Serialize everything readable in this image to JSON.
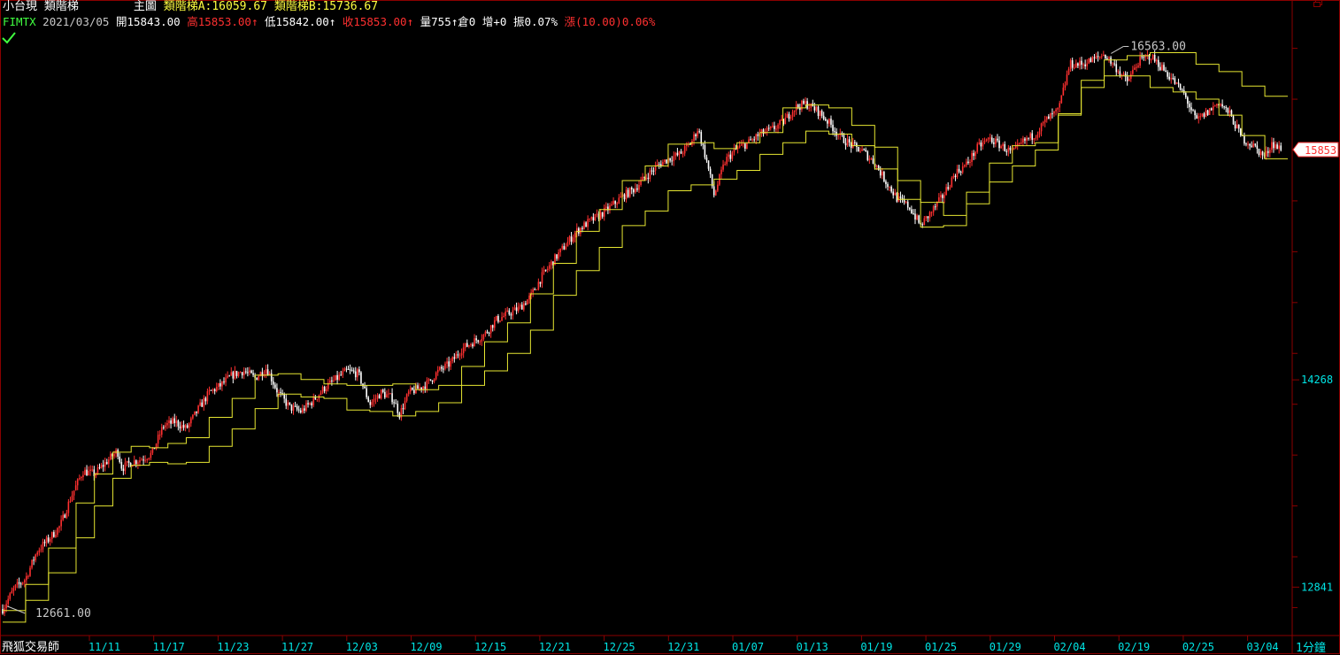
{
  "header": {
    "instrument_name": "小台現",
    "indicator_name": "類階梯",
    "main_label": "主圖",
    "stair_a_label": "類階梯A:",
    "stair_a_value": "16059.67",
    "stair_b_label": "類階梯B:",
    "stair_b_value": "15736.67",
    "symbol": "FIMTX",
    "date": "2021/03/05",
    "open_label": "開",
    "open_value": "15843.00",
    "high_label": "高",
    "high_value": "15853.00",
    "low_label": "低",
    "low_value": "15842.00",
    "close_label": "收",
    "close_value": "15853.00",
    "volume_label": "量",
    "volume_value": "755",
    "oi_label": "倉",
    "oi_value": "0",
    "oi_change_label": "增",
    "oi_change_value": "+0",
    "amplitude_label": "振",
    "amplitude_value": "0.07%",
    "change_label": "漲",
    "change_value": "(10.00)",
    "change_pct": "0.06%",
    "arrow_up": "↑"
  },
  "footer": {
    "brand": "飛狐交易師",
    "period": "1分鐘"
  },
  "colors": {
    "background": "#000000",
    "frame": "#8b0000",
    "axis_text": "#00e5e5",
    "stair_line": "#e6e632",
    "candle_up": "#ff3030",
    "candle_down": "#ffffff",
    "price_tag": "#ff3030"
  },
  "icons": [
    "check-icon",
    "window-restore-icon"
  ],
  "chart_data": {
    "type": "candlestick",
    "y_ticks": [
      12841,
      14268
    ],
    "ylim": [
      12520,
      16700
    ],
    "x_ticks": [
      "11/11",
      "11/17",
      "11/23",
      "11/27",
      "12/03",
      "12/09",
      "12/15",
      "12/21",
      "12/25",
      "12/31",
      "01/07",
      "01/13",
      "01/19",
      "01/25",
      "01/29",
      "02/04",
      "02/19",
      "02/25",
      "03/04"
    ],
    "last_price": "15853",
    "max_label": "16563.00",
    "min_label": "12661.00",
    "grid": false,
    "price_path": [
      [
        0,
        12690
      ],
      [
        0.5,
        12830
      ],
      [
        1,
        12900
      ],
      [
        1.5,
        13090
      ],
      [
        2,
        13170
      ],
      [
        2.5,
        13260
      ],
      [
        3,
        13470
      ],
      [
        3.5,
        13640
      ],
      [
        4,
        13620
      ],
      [
        4.5,
        13700
      ],
      [
        5,
        13780
      ],
      [
        5.2,
        13660
      ],
      [
        5.6,
        13700
      ],
      [
        6,
        13720
      ],
      [
        6.5,
        13760
      ],
      [
        7,
        13950
      ],
      [
        7.5,
        13980
      ],
      [
        8,
        13930
      ],
      [
        8.5,
        14060
      ],
      [
        9,
        14180
      ],
      [
        9.5,
        14230
      ],
      [
        10,
        14300
      ],
      [
        10.5,
        14330
      ],
      [
        11,
        14280
      ],
      [
        11.5,
        14350
      ],
      [
        12,
        14180
      ],
      [
        12.5,
        14080
      ],
      [
        13,
        14050
      ],
      [
        13.5,
        14120
      ],
      [
        14,
        14210
      ],
      [
        14.5,
        14270
      ],
      [
        15,
        14330
      ],
      [
        15.5,
        14310
      ],
      [
        16,
        14100
      ],
      [
        16.5,
        14180
      ],
      [
        17,
        14140
      ],
      [
        17.3,
        14030
      ],
      [
        17.7,
        14180
      ],
      [
        18,
        14200
      ],
      [
        18.5,
        14240
      ],
      [
        19,
        14330
      ],
      [
        19.5,
        14380
      ],
      [
        20,
        14480
      ],
      [
        20.5,
        14530
      ],
      [
        21,
        14580
      ],
      [
        21.5,
        14680
      ],
      [
        22,
        14720
      ],
      [
        22.5,
        14760
      ],
      [
        23,
        14840
      ],
      [
        23.5,
        14980
      ],
      [
        24,
        15090
      ],
      [
        24.5,
        15190
      ],
      [
        25,
        15290
      ],
      [
        25.5,
        15350
      ],
      [
        26,
        15400
      ],
      [
        26.5,
        15460
      ],
      [
        27,
        15530
      ],
      [
        27.5,
        15580
      ],
      [
        28,
        15660
      ],
      [
        28.5,
        15740
      ],
      [
        29,
        15790
      ],
      [
        29.5,
        15820
      ],
      [
        30,
        15900
      ],
      [
        30.3,
        16000
      ],
      [
        30.7,
        15760
      ],
      [
        31,
        15540
      ],
      [
        31.5,
        15780
      ],
      [
        32,
        15860
      ],
      [
        32.5,
        15900
      ],
      [
        33,
        15960
      ],
      [
        33.5,
        15990
      ],
      [
        34,
        16040
      ],
      [
        34.5,
        16140
      ],
      [
        35,
        16170
      ],
      [
        35.5,
        16120
      ],
      [
        36,
        16040
      ],
      [
        36.5,
        15940
      ],
      [
        37,
        15880
      ],
      [
        37.5,
        15840
      ],
      [
        38,
        15760
      ],
      [
        38.5,
        15630
      ],
      [
        39,
        15510
      ],
      [
        39.5,
        15460
      ],
      [
        40,
        15330
      ],
      [
        40.5,
        15430
      ],
      [
        41,
        15540
      ],
      [
        41.5,
        15690
      ],
      [
        42,
        15750
      ],
      [
        42.5,
        15870
      ],
      [
        43,
        15930
      ],
      [
        43.5,
        15880
      ],
      [
        44,
        15830
      ],
      [
        44.5,
        15910
      ],
      [
        45,
        15960
      ],
      [
        45.5,
        16060
      ],
      [
        46,
        16120
      ],
      [
        46.5,
        16440
      ],
      [
        47,
        16440
      ],
      [
        47.5,
        16470
      ],
      [
        48,
        16510
      ],
      [
        48.5,
        16420
      ],
      [
        49,
        16320
      ],
      [
        49.5,
        16460
      ],
      [
        50,
        16500
      ],
      [
        50.5,
        16420
      ],
      [
        51,
        16330
      ],
      [
        51.5,
        16230
      ],
      [
        52,
        16050
      ],
      [
        52.5,
        16110
      ],
      [
        53,
        16180
      ],
      [
        53.5,
        16090
      ],
      [
        54,
        15930
      ],
      [
        54.5,
        15880
      ],
      [
        55,
        15800
      ],
      [
        55.3,
        15900
      ],
      [
        55.7,
        15853
      ]
    ],
    "stair_a": [
      [
        0,
        12680
      ],
      [
        1.0,
        12860
      ],
      [
        2.0,
        13110
      ],
      [
        3.2,
        13420
      ],
      [
        4.0,
        13620
      ],
      [
        4.8,
        13770
      ],
      [
        5.6,
        13810
      ],
      [
        6.4,
        13800
      ],
      [
        7.2,
        13830
      ],
      [
        8.0,
        13870
      ],
      [
        9.0,
        14010
      ],
      [
        10.0,
        14140
      ],
      [
        11.0,
        14300
      ],
      [
        12.0,
        14310
      ],
      [
        13.0,
        14270
      ],
      [
        14.0,
        14240
      ],
      [
        15.0,
        14230
      ],
      [
        16.0,
        14230
      ],
      [
        17.0,
        14240
      ],
      [
        18.0,
        14200
      ],
      [
        19.0,
        14230
      ],
      [
        20.0,
        14360
      ],
      [
        21.0,
        14530
      ],
      [
        22.0,
        14660
      ],
      [
        23.0,
        14860
      ],
      [
        24.0,
        15070
      ],
      [
        25.0,
        15290
      ],
      [
        26.0,
        15440
      ],
      [
        27.0,
        15640
      ],
      [
        28.0,
        15740
      ],
      [
        29.0,
        15890
      ],
      [
        30.0,
        15900
      ],
      [
        31.0,
        15860
      ],
      [
        32.0,
        15900
      ],
      [
        33.0,
        15970
      ],
      [
        34.0,
        16140
      ],
      [
        35.0,
        16160
      ],
      [
        36.0,
        16140
      ],
      [
        37.0,
        16020
      ],
      [
        38.0,
        15870
      ],
      [
        39.0,
        15640
      ],
      [
        40.0,
        15490
      ],
      [
        41.0,
        15400
      ],
      [
        42.0,
        15560
      ],
      [
        43.0,
        15760
      ],
      [
        44.0,
        15880
      ],
      [
        45.0,
        15900
      ],
      [
        46.0,
        16100
      ],
      [
        47.0,
        16330
      ],
      [
        48.0,
        16470
      ],
      [
        49.0,
        16500
      ],
      [
        50.0,
        16520
      ],
      [
        51.0,
        16520
      ],
      [
        52.0,
        16440
      ],
      [
        53.0,
        16390
      ],
      [
        54.0,
        16290
      ],
      [
        55.0,
        16220
      ],
      [
        56.0,
        16220
      ]
    ],
    "stair_b": [
      [
        0,
        12600
      ],
      [
        1.0,
        12750
      ],
      [
        2.0,
        12940
      ],
      [
        3.2,
        13180
      ],
      [
        4.0,
        13400
      ],
      [
        4.8,
        13590
      ],
      [
        5.6,
        13680
      ],
      [
        6.4,
        13700
      ],
      [
        7.2,
        13690
      ],
      [
        8.0,
        13700
      ],
      [
        9.0,
        13810
      ],
      [
        10.0,
        13930
      ],
      [
        11.0,
        14070
      ],
      [
        12.0,
        14170
      ],
      [
        13.0,
        14150
      ],
      [
        14.0,
        14140
      ],
      [
        15.0,
        14060
      ],
      [
        16.0,
        14050
      ],
      [
        17.0,
        14020
      ],
      [
        18.0,
        14050
      ],
      [
        19.0,
        14110
      ],
      [
        20.0,
        14230
      ],
      [
        21.0,
        14330
      ],
      [
        22.0,
        14450
      ],
      [
        23.0,
        14610
      ],
      [
        24.0,
        14850
      ],
      [
        25.0,
        15020
      ],
      [
        26.0,
        15180
      ],
      [
        27.0,
        15330
      ],
      [
        28.0,
        15430
      ],
      [
        29.0,
        15570
      ],
      [
        30.0,
        15610
      ],
      [
        31.0,
        15650
      ],
      [
        32.0,
        15710
      ],
      [
        33.0,
        15820
      ],
      [
        34.0,
        15900
      ],
      [
        35.0,
        15980
      ],
      [
        36.0,
        15960
      ],
      [
        37.0,
        15880
      ],
      [
        38.0,
        15720
      ],
      [
        39.0,
        15510
      ],
      [
        40.0,
        15320
      ],
      [
        41.0,
        15330
      ],
      [
        42.0,
        15480
      ],
      [
        43.0,
        15630
      ],
      [
        44.0,
        15740
      ],
      [
        45.0,
        15850
      ],
      [
        46.0,
        16090
      ],
      [
        47.0,
        16280
      ],
      [
        48.0,
        16360
      ],
      [
        49.0,
        16360
      ],
      [
        50.0,
        16280
      ],
      [
        51.0,
        16250
      ],
      [
        52.0,
        16200
      ],
      [
        53.0,
        16090
      ],
      [
        54.0,
        15950
      ],
      [
        55.0,
        15790
      ],
      [
        56.0,
        15790
      ]
    ]
  }
}
